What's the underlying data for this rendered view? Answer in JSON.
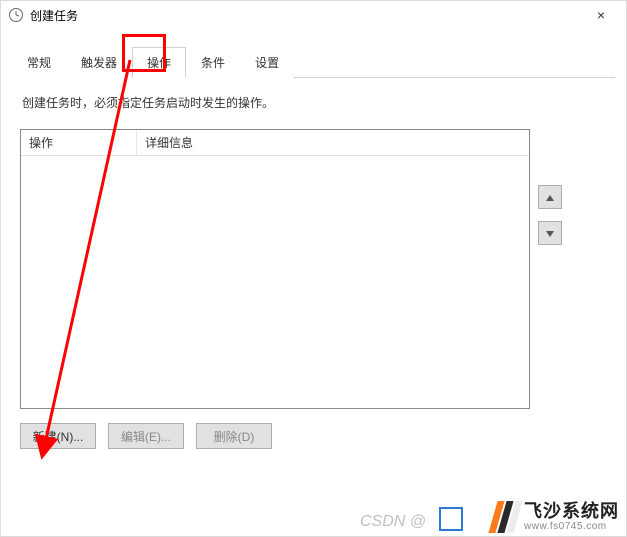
{
  "window": {
    "title": "创建任务",
    "close_icon": "×"
  },
  "tabs": {
    "general": "常规",
    "triggers": "触发器",
    "actions": "操作",
    "conditions": "条件",
    "settings": "设置"
  },
  "panel": {
    "description": "创建任务时，必须指定任务启动时发生的操作。",
    "columns": {
      "action": "操作",
      "detail": "详细信息"
    }
  },
  "buttons": {
    "new": "新建(N)...",
    "edit": "编辑(E)...",
    "delete": "删除(D)"
  },
  "watermark": "CSDN @",
  "logo": {
    "main": "飞沙系统网",
    "sub": "www.fs0745.com"
  },
  "colors": {
    "logo_orange": "#ff7a1a",
    "logo_dark": "#2a2a2a",
    "logo_light": "#ededed",
    "highlight": "#ff0000"
  }
}
